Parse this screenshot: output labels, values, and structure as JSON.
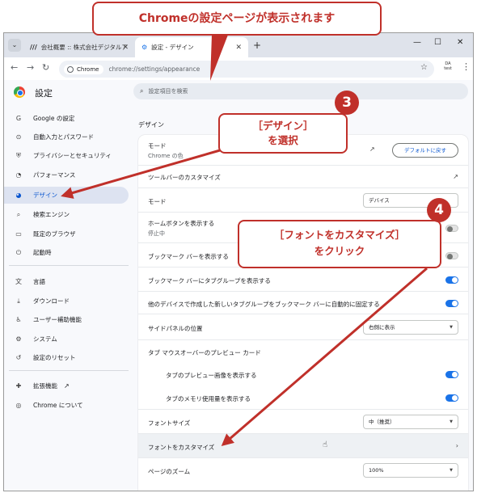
{
  "browser": {
    "tabs": [
      {
        "title": "会社概要 :: 株式会社デジタルアドバンテージ",
        "active": false
      },
      {
        "title": "設定 - デザイン",
        "active": true
      }
    ],
    "new_tab": "+",
    "address_chip": "Chrome",
    "url": "chrome://settings/appearance",
    "profile_label": "DA test",
    "window_controls": {
      "minimize": "—",
      "restore": "☐",
      "close": "✕"
    }
  },
  "header": {
    "title": "設定",
    "search_placeholder": "設定項目を検索"
  },
  "sidebar": {
    "items": [
      {
        "label": "Google の設定",
        "icon": "G"
      },
      {
        "label": "自動入力とパスワード",
        "icon": "⊙"
      },
      {
        "label": "プライバシーとセキュリティ",
        "icon": "⛨"
      },
      {
        "label": "パフォーマンス",
        "icon": "◔"
      },
      {
        "label": "デザイン",
        "icon": "◕",
        "active": true
      },
      {
        "label": "検索エンジン",
        "icon": "⌕"
      },
      {
        "label": "既定のブラウザ",
        "icon": "▭"
      },
      {
        "label": "起動時",
        "icon": "⏻"
      },
      {
        "label": "言語",
        "icon": "文"
      },
      {
        "label": "ダウンロード",
        "icon": "⤓"
      },
      {
        "label": "ユーザー補助機能",
        "icon": "♿"
      },
      {
        "label": "システム",
        "icon": "⚙"
      },
      {
        "label": "設定のリセット",
        "icon": "↺"
      },
      {
        "label": "拡張機能",
        "icon": "✚"
      },
      {
        "label": "Chrome について",
        "icon": "◎"
      }
    ]
  },
  "content": {
    "section_title": "デザイン",
    "mode_row": {
      "label": "モード",
      "sublabel": "Chrome の色",
      "reset_button": "デフォルトに戻す"
    },
    "toolbar_customize": "ツールバーのカスタマイズ",
    "mode_select": {
      "label": "モード",
      "value": "デバイス"
    },
    "home_button": {
      "label": "ホームボタンを表示する",
      "sublabel": "停止中",
      "on": false
    },
    "bookmark_bar": {
      "label": "ブックマーク バーを表示する",
      "on": false
    },
    "bookmark_tab_groups": {
      "label": "ブックマーク バーにタブグループを表示する",
      "on": true
    },
    "auto_pin_groups": {
      "label": "他のデバイスで作成した新しいタブグループをブックマーク バーに自動的に固定する",
      "on": true
    },
    "side_panel": {
      "label": "サイドパネルの位置",
      "value": "右側に表示"
    },
    "hover_preview_title": "タブ マウスオーバーのプレビュー カード",
    "preview_image": {
      "label": "タブのプレビュー画像を表示する",
      "on": true
    },
    "memory_usage": {
      "label": "タブのメモリ使用量を表示する",
      "on": true
    },
    "font_size": {
      "label": "フォントサイズ",
      "value": "中（推奨）"
    },
    "customize_fonts": "フォントをカスタマイズ",
    "page_zoom": {
      "label": "ページのズーム",
      "value": "100%"
    }
  },
  "annotations": {
    "top": "Chromeの設定ページが表示されます",
    "step3_number": "3",
    "step3_line1": "［デザイン］",
    "step3_line2": "を選択",
    "step4_number": "4",
    "step4_line1": "［フォントをカスタマイズ］",
    "step4_line2": "をクリック",
    "color": "#c0302a"
  }
}
